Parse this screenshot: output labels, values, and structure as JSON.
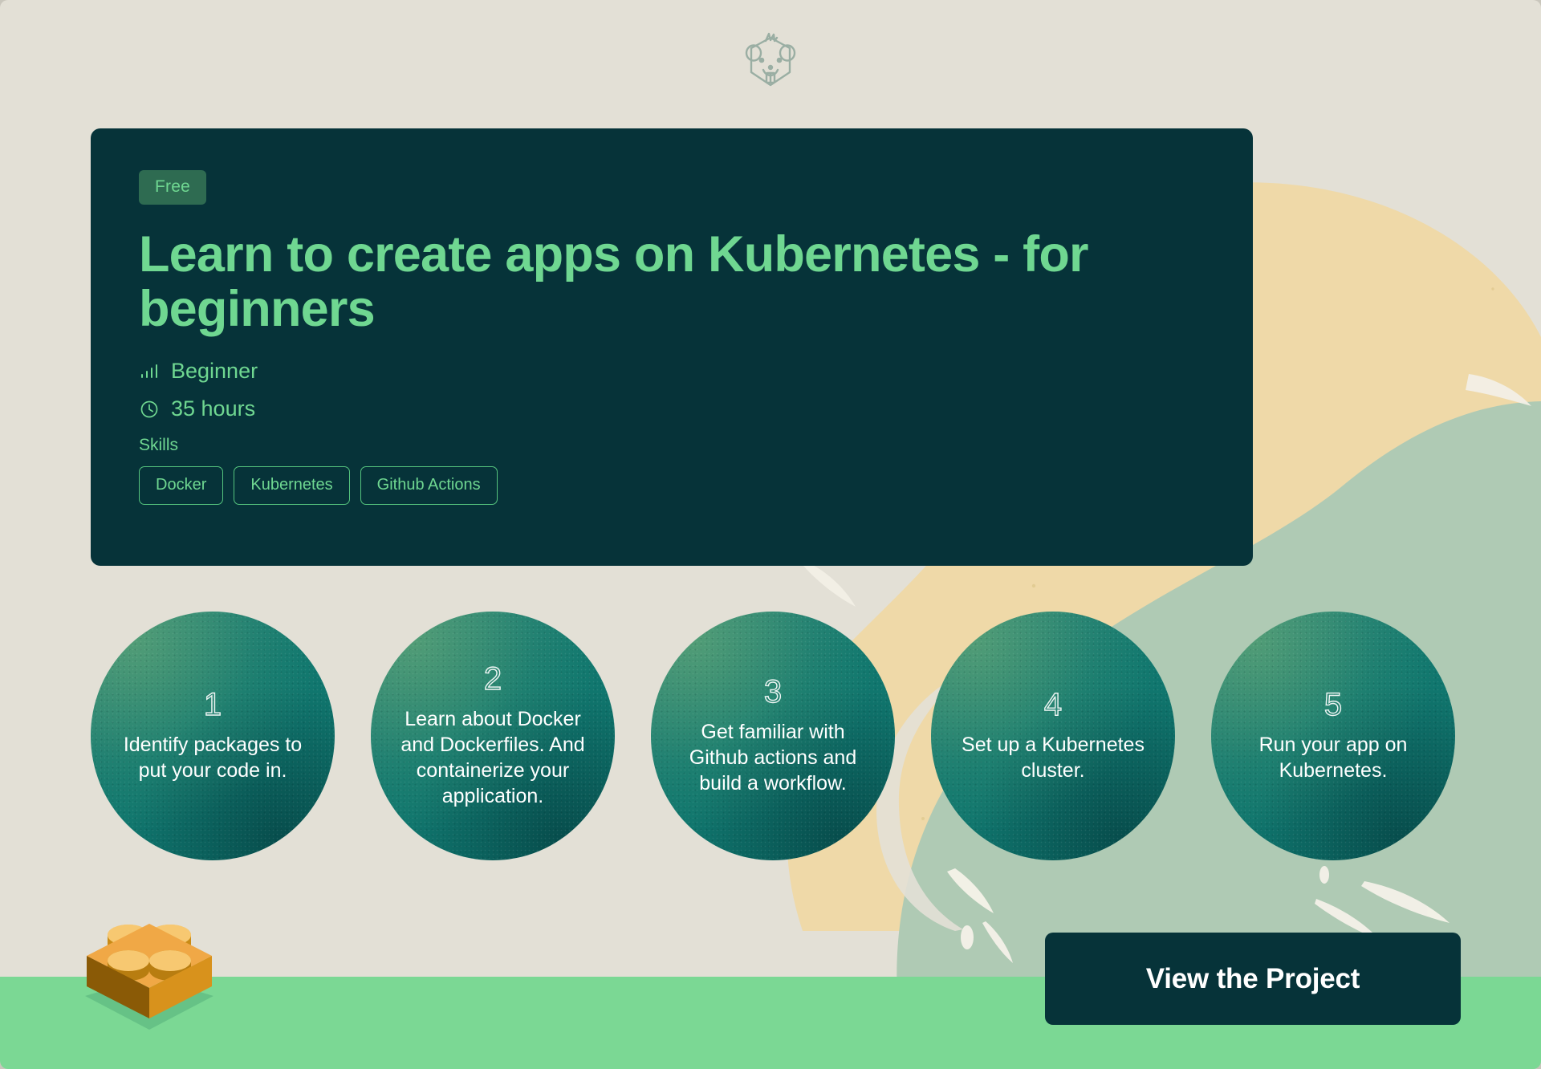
{
  "brand": {
    "logo_icon": "beaver-icon"
  },
  "course": {
    "badge": "Free",
    "title": "Learn to create apps on Kubernetes - for beginners",
    "meta": [
      {
        "icon": "signal-bars-icon",
        "label": "Beginner"
      },
      {
        "icon": "clock-icon",
        "label": "35 hours"
      }
    ],
    "skills_label": "Skills",
    "skills": [
      "Docker",
      "Kubernetes",
      "Github Actions"
    ]
  },
  "steps": [
    {
      "number": "1",
      "text": "Identify packages to put your code in."
    },
    {
      "number": "2",
      "text": "Learn about Docker and Dockerfiles. And containerize your application."
    },
    {
      "number": "3",
      "text": "Get familiar with Github actions and build a workflow."
    },
    {
      "number": "4",
      "text": "Set up a Kubernetes cluster."
    },
    {
      "number": "5",
      "text": "Run your app on Kubernetes."
    }
  ],
  "decor": {
    "lego_icon": "lego-brick-icon"
  },
  "cta": {
    "label": "View the Project"
  },
  "colors": {
    "page_background": "#E3E0D6",
    "card_background": "#063339",
    "accent_green": "#6FD791",
    "badge_background": "#2E6B51",
    "tag_border": "#55C47E",
    "circle_teal": "#11786F",
    "strip_green": "#7BD894",
    "sage_shape": "#AFCAB4",
    "tan_shape": "#EFD9A8",
    "lego_orange": "#E2981E"
  }
}
